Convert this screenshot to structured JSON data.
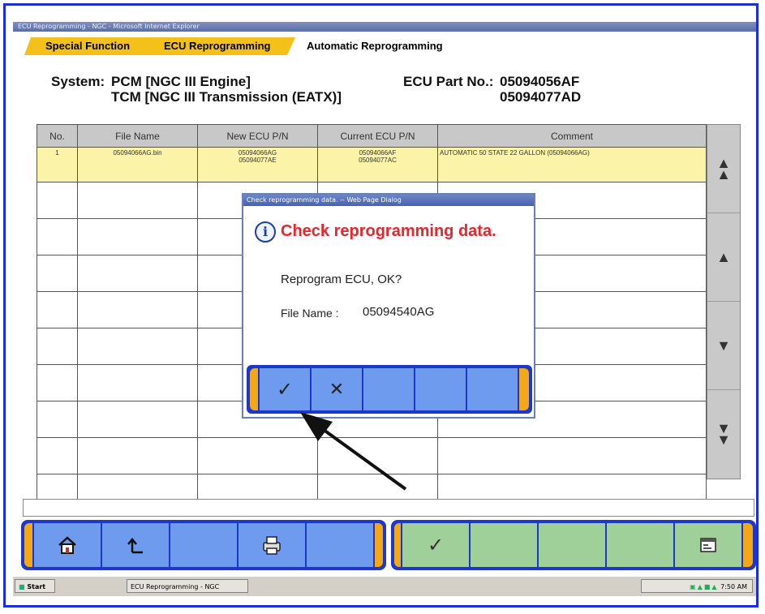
{
  "window": {
    "title": "ECU Reprogramming - NGC - Microsoft Internet Explorer"
  },
  "breadcrumb": [
    "Special Function",
    "ECU Reprogramming",
    "Automatic Reprogramming"
  ],
  "system": {
    "label": "System:",
    "pcm": "PCM  [NGC III Engine]",
    "tcm": "TCM  [NGC III Transmission (EATX)]",
    "part_label": "ECU Part No.:",
    "part1": "05094056AF",
    "part2": "05094077AD"
  },
  "table": {
    "headers": [
      "No.",
      "File Name",
      "New ECU P/N",
      "Current ECU P/N",
      "Comment"
    ],
    "row1": {
      "no": "1",
      "file": "05094066AG.bin",
      "new1": "05094066AG",
      "new2": "05094077AE",
      "cur1": "05094066AF",
      "cur2": "05094077AC",
      "comment": "AUTOMATIC 50 STATE 22 GALLON (05094066AG)"
    }
  },
  "dialog": {
    "title": "Check reprogramming data. -- Web Page Dialog",
    "heading": "Check reprogramming data.",
    "question": "Reprogram ECU, OK?",
    "file_label": "File Name :",
    "file_value": "05094540AG",
    "ok_glyph": "✓",
    "cancel_glyph": "✕"
  },
  "taskbar": {
    "start": "Start",
    "task": "ECU Reprogramming - NGC",
    "clock": "7:50 AM"
  },
  "colors": {
    "accent_blue": "#1d38c8",
    "tab_yellow": "#f3c11a",
    "heading_red": "#e8252c",
    "row_highlight": "#fbf3a8"
  }
}
